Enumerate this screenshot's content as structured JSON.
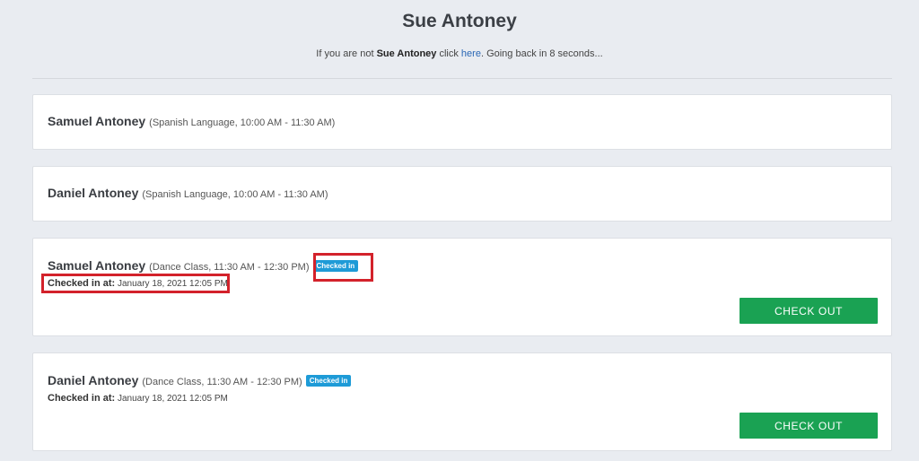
{
  "header": {
    "title": "Sue Antoney",
    "notice_prefix": "If you are not",
    "notice_name": "Sue Antoney",
    "notice_click": "click",
    "notice_link": "here",
    "notice_suffix": ". Going back in 8 seconds..."
  },
  "entries": [
    {
      "student": "Samuel Antoney",
      "class_info": "(Spanish Language, 10:00 AM - 11:30 AM)"
    },
    {
      "student": "Daniel Antoney",
      "class_info": "(Spanish Language, 10:00 AM - 11:30 AM)"
    },
    {
      "student": "Samuel Antoney",
      "class_info": "(Dance Class, 11:30 AM - 12:30 PM)",
      "status_badge": "Checked in",
      "checked_in_label": "Checked in at:",
      "checked_in_time": "January 18, 2021 12:05 PM",
      "button_label": "CHECK OUT"
    },
    {
      "student": "Daniel Antoney",
      "class_info": "(Dance Class, 11:30 AM - 12:30 PM)",
      "status_badge": "Checked in",
      "checked_in_label": "Checked in at:",
      "checked_in_time": "January 18, 2021 12:05 PM",
      "button_label": "CHECK OUT"
    }
  ],
  "colors": {
    "background": "#e9ecf1",
    "badge": "#1e9bd7",
    "checkout_button": "#1aa253",
    "highlight_annotation": "#d3222b",
    "link": "#2a67b5"
  }
}
